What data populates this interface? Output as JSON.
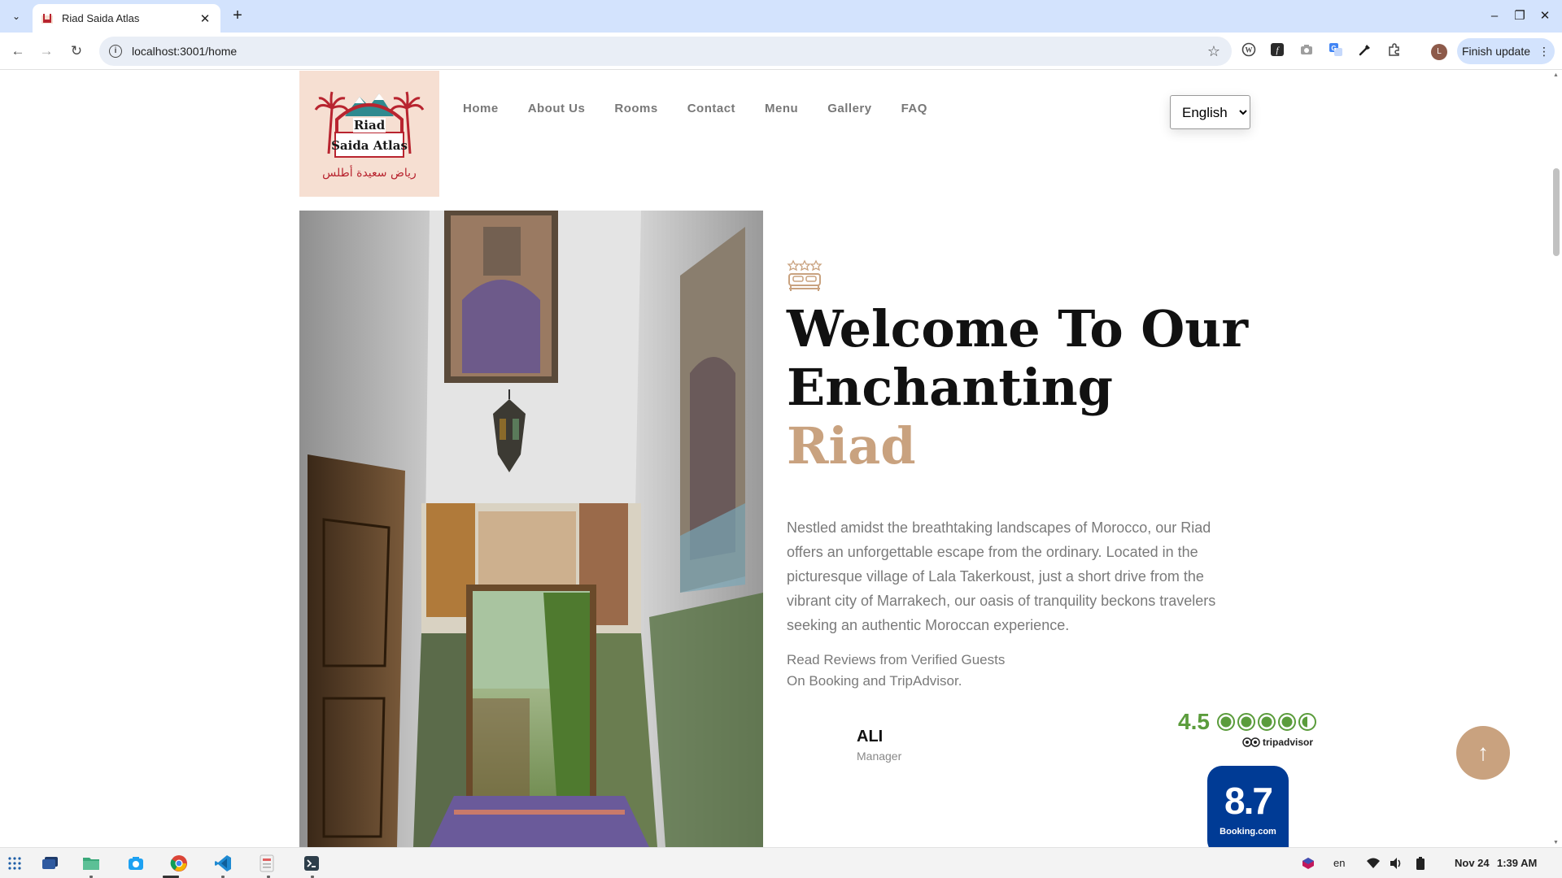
{
  "browser": {
    "tab_title": "Riad Saida Atlas",
    "url": "localhost:3001/home",
    "update_button": "Finish update",
    "profile_initial": "L"
  },
  "site": {
    "nav": [
      "Home",
      "About Us",
      "Rooms",
      "Contact",
      "Menu",
      "Gallery",
      "FAQ"
    ],
    "language": {
      "selected": "English"
    },
    "logo": {
      "title_top": "Riad",
      "title_main": "Saida Atlas",
      "arabic": "رياض سعيدة أطلس"
    },
    "hero": {
      "heading_line1": "Welcome To Our",
      "heading_line2": "Enchanting",
      "heading_accent": "Riad",
      "description": "Nestled amidst the breathtaking landscapes of Morocco, our Riad offers an unforgettable escape from the ordinary. Located in the picturesque village of Lala Takerkoust, just a short drive from the vibrant city of Marrakech, our oasis of tranquility beckons travelers seeking an authentic Moroccan experience.",
      "reviews_line1": "Read Reviews from Verified Guests",
      "reviews_line2": "On Booking and TripAdvisor."
    },
    "reviewer": {
      "name": "ALI",
      "role": "Manager"
    },
    "tripadvisor": {
      "score": "4.5",
      "rating": 4.5,
      "brand": "tripadvisor"
    },
    "booking": {
      "score": "8.7",
      "brand": "Booking.com"
    }
  },
  "colors": {
    "accent": "#c9a27f",
    "tripadvisor_green": "#5b9c3c",
    "booking_blue": "#003b95",
    "logo_red": "#b8242f"
  },
  "taskbar": {
    "language": "en",
    "date": "Nov 24",
    "time": "1:39 AM"
  }
}
